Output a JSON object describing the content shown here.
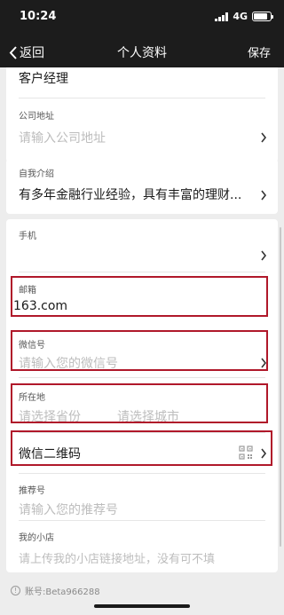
{
  "status": {
    "time": "10:24",
    "network": "4G",
    "battery_level": 0.85
  },
  "nav": {
    "back_label": "返回",
    "title": "个人资料",
    "save_label": "保存"
  },
  "card1": {
    "position_value": "客户经理",
    "company_address": {
      "label": "公司地址",
      "placeholder": "请输入公司地址"
    }
  },
  "card2": {
    "intro": {
      "label": "自我介绍",
      "value": "有多年金融行业经验，具有丰富的理财..."
    }
  },
  "card3": {
    "phone": {
      "label": "手机",
      "value": ""
    },
    "email": {
      "label": "邮箱",
      "value": "163.com"
    },
    "wechat": {
      "label": "微信号",
      "placeholder": "请输入您的微信号"
    },
    "location": {
      "label": "所在地",
      "province_placeholder": "请选择省份",
      "city_placeholder": "请选择城市"
    },
    "qrcode": {
      "label": "微信二维码",
      "icon": "qr-code-icon"
    },
    "referral": {
      "label": "推荐号",
      "placeholder": "请输入您的推荐号"
    },
    "shop": {
      "label": "我的小店",
      "placeholder": "请上传我的小店链接地址，没有可不填"
    }
  },
  "footer": {
    "account_text": "账号:Beta966288"
  },
  "colors": {
    "header_bg": "#1c1c1c",
    "page_bg": "#ededed",
    "highlight": "#b0182a"
  }
}
